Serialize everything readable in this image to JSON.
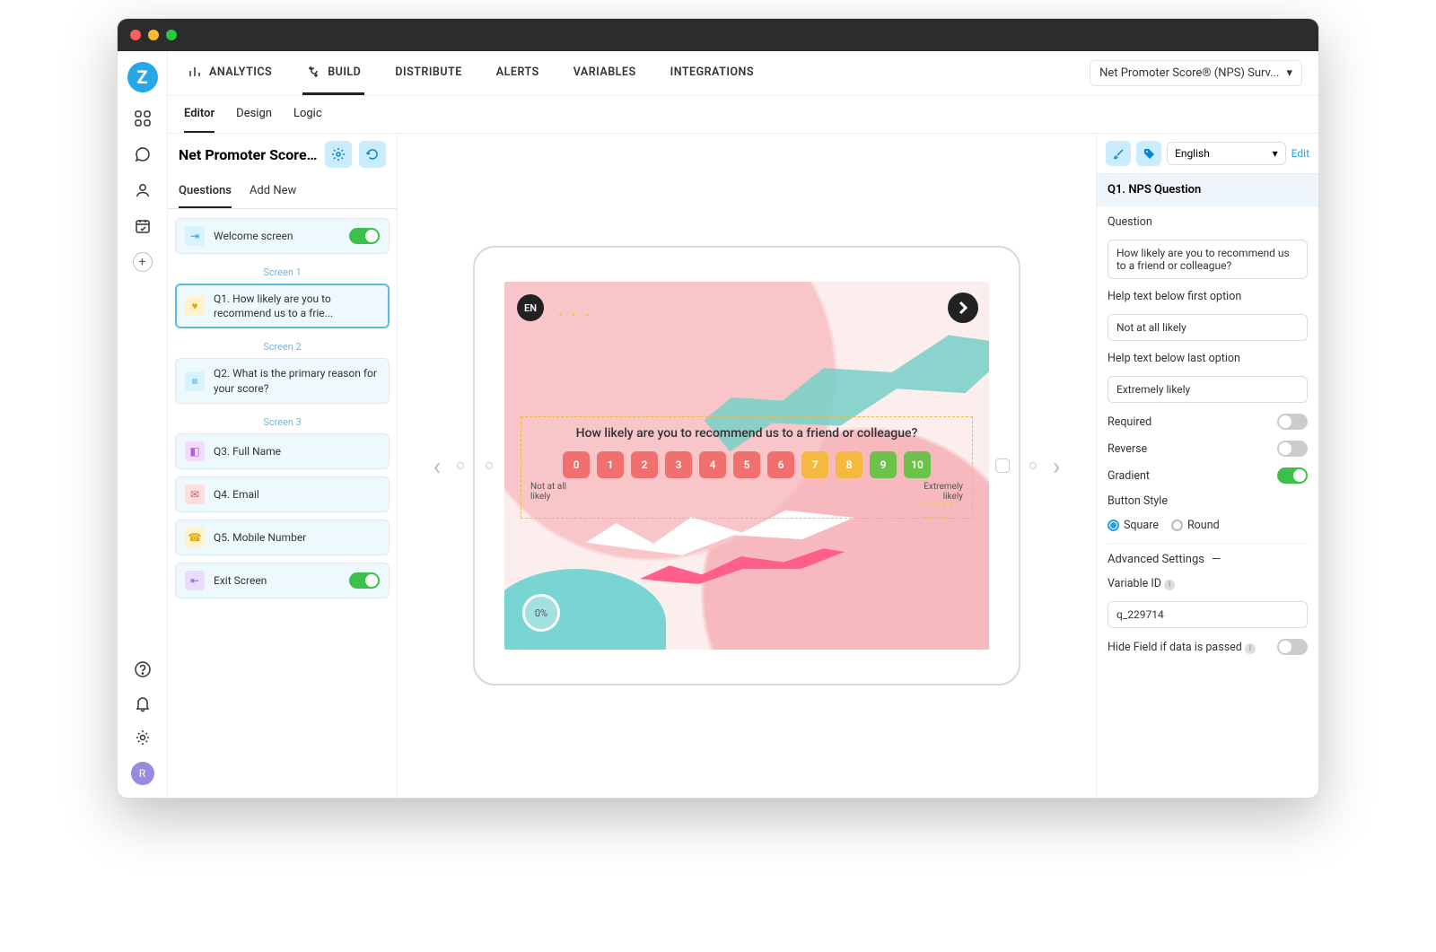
{
  "nav": {
    "analytics": "ANALYTICS",
    "build": "BUILD",
    "distribute": "DISTRIBUTE",
    "alerts": "ALERTS",
    "variables": "VARIABLES",
    "integrations": "INTEGRATIONS",
    "survey_dropdown": "Net Promoter Score® (NPS) Surv..."
  },
  "subtabs": {
    "editor": "Editor",
    "design": "Design",
    "logic": "Logic"
  },
  "left": {
    "title": "Net Promoter Score...",
    "tab_questions": "Questions",
    "tab_addnew": "Add New",
    "welcome": "Welcome screen",
    "screen1": "Screen 1",
    "q1": "Q1. How likely are you to recommend us to a frie...",
    "screen2": "Screen 2",
    "q2": "Q2. What is the primary reason for your score?",
    "screen3": "Screen 3",
    "q3": "Q3. Full Name",
    "q4": "Q4. Email",
    "q5": "Q5. Mobile Number",
    "exit": "Exit Screen"
  },
  "preview": {
    "lang_badge": "EN",
    "question": "How likely are you to recommend us to a friend or colleague?",
    "low_label": "Not at all likely",
    "high_label": "Extremely likely",
    "progress": "0%",
    "scale": [
      "0",
      "1",
      "2",
      "3",
      "4",
      "5",
      "6",
      "7",
      "8",
      "9",
      "10"
    ]
  },
  "right": {
    "language": "English",
    "edit": "Edit",
    "header": "Q1. NPS Question",
    "question_label": "Question",
    "question_value": "How likely are you to recommend us to a friend or colleague?",
    "help_first_label": "Help text below first option",
    "help_first_value": "Not at all likely",
    "help_last_label": "Help text below last option",
    "help_last_value": "Extremely likely",
    "required": "Required",
    "reverse": "Reverse",
    "gradient": "Gradient",
    "button_style": "Button Style",
    "square": "Square",
    "round": "Round",
    "advanced": "Advanced Settings",
    "variable_id_label": "Variable ID",
    "variable_id_value": "q_229714",
    "hide_field": "Hide Field if data is passed"
  },
  "avatar": "R"
}
